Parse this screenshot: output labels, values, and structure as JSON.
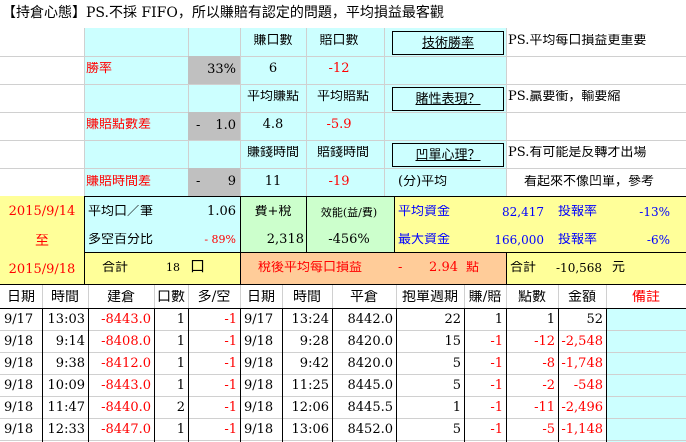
{
  "header": {
    "title": "【持倉心態】PS.不採 FIFO，所以賺賠有認定的問題，平均損益最客觀"
  },
  "row1": {
    "win_count_label": "賺口數",
    "loss_count_label": "賠口數",
    "tech_win_rate": "技術勝率",
    "ps1": "PS.平均每口損益更重要"
  },
  "row2": {
    "win_rate_label": "勝率",
    "win_rate_value": "33%",
    "win_count": "6",
    "loss_count": "-12"
  },
  "row3": {
    "avg_win_label": "平均賺點",
    "avg_loss_label": "平均賠點",
    "gambling": "賭性表現？",
    "ps2": "PS.贏要衝，輸要縮"
  },
  "row4": {
    "diff_label": "賺賠點數差",
    "diff_sign": "-",
    "diff_value": "1.0",
    "avg_win": "4.8",
    "avg_loss": "-5.9"
  },
  "row5": {
    "win_time_label": "賺錢時間",
    "loss_time_label": "賠錢時間",
    "bottom_fishing": "凹單心理？",
    "ps3": "PS.有可能是反轉才出場"
  },
  "row6": {
    "time_diff_label": "賺賠時間差",
    "time_sign": "-",
    "time_value": "9",
    "win_time": "11",
    "loss_time": "-19",
    "avg_unit": "(分)平均",
    "note": "看起來不像凹單，參考"
  },
  "summary": {
    "date_start": "2015/9/14",
    "to": "至",
    "date_end": "2015/9/18",
    "avg_per_lot_label": "平均口／筆",
    "avg_per_lot": "1.06",
    "fee_tax_label": "費+稅",
    "fee_tax": "2,318",
    "efficiency_label": "效能(益/費)",
    "efficiency": "-456%",
    "avg_capital_label": "平均資金",
    "avg_capital": "82,417",
    "roi_label_1": "投報率",
    "roi_1": "-13%",
    "long_short_label": "多空百分比",
    "long_short": "- 89%",
    "max_capital_label": "最大資金",
    "max_capital": "166,000",
    "roi_label_2": "投報率",
    "roi_2": "-6%",
    "total_label": "合計",
    "total_lots": "18",
    "lot_unit": "口",
    "after_tax_label": "稅後平均每口損益",
    "after_tax_sign": "-",
    "after_tax_value": "2.94",
    "point_unit": "點",
    "total_label_2": "合計",
    "total_amount": "-10,568",
    "currency": "元"
  },
  "table": {
    "headers": [
      "日期",
      "時間",
      "建倉",
      "口數",
      "多/空",
      "日期",
      "時間",
      "平倉",
      "抱單週期",
      "賺/賠",
      "點數",
      "金額",
      "備註"
    ],
    "rows": [
      [
        "9/17",
        "13:03",
        "-8443.0",
        "1",
        "-1",
        "9/17",
        "13:24",
        "8442.0",
        "22",
        "1",
        "1",
        "52",
        ""
      ],
      [
        "9/18",
        "9:14",
        "-8408.0",
        "1",
        "-1",
        "9/18",
        "9:28",
        "8420.0",
        "15",
        "-1",
        "-12",
        "-2,548",
        ""
      ],
      [
        "9/18",
        "9:38",
        "-8412.0",
        "1",
        "-1",
        "9/18",
        "9:42",
        "8420.0",
        "5",
        "-1",
        "-8",
        "-1,748",
        ""
      ],
      [
        "9/18",
        "10:09",
        "-8443.0",
        "1",
        "-1",
        "9/18",
        "11:25",
        "8445.0",
        "5",
        "-1",
        "-2",
        "-548",
        ""
      ],
      [
        "9/18",
        "11:47",
        "-8440.0",
        "2",
        "-1",
        "9/18",
        "12:06",
        "8445.5",
        "1",
        "-1",
        "-11",
        "-2,496",
        ""
      ],
      [
        "9/18",
        "12:33",
        "-8447.0",
        "1",
        "-1",
        "9/18",
        "13:06",
        "8452.0",
        "5",
        "-1",
        "-5",
        "-1,148",
        ""
      ]
    ]
  },
  "colors": {
    "cyan": "#ccffff",
    "gray": "#c0c0c0",
    "yellow": "#ffff99",
    "green": "#ccffcc",
    "orange": "#ffcc99",
    "red": "#ff0000",
    "blue": "#0000ff"
  }
}
